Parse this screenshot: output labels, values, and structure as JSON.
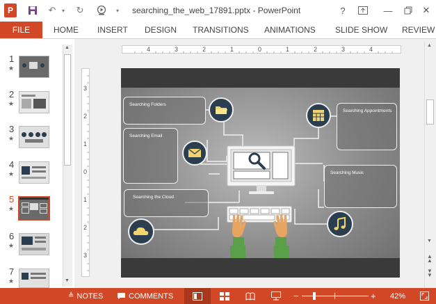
{
  "window": {
    "title": "searching_the_web_17891.pptx - PowerPoint",
    "help": "?",
    "minimize": "—",
    "close": "✕"
  },
  "ribbon": {
    "file": "FILE",
    "tabs": [
      "HOME",
      "INSERT",
      "DESIGN",
      "TRANSITIONS",
      "ANIMATIONS",
      "SLIDE SHOW",
      "REVIEW"
    ]
  },
  "thumbnails": [
    {
      "num": "1",
      "star": "★"
    },
    {
      "num": "2",
      "star": "★"
    },
    {
      "num": "3",
      "star": "★"
    },
    {
      "num": "4",
      "star": "★"
    },
    {
      "num": "5",
      "star": "★",
      "selected": true
    },
    {
      "num": "6",
      "star": "★"
    },
    {
      "num": "7",
      "star": "★"
    }
  ],
  "ruler": {
    "top": [
      "4",
      "3",
      "2",
      "1",
      "0",
      "1",
      "2",
      "3",
      "4"
    ],
    "left": [
      "3",
      "2",
      "1",
      "0",
      "1",
      "2",
      "3"
    ]
  },
  "slide": {
    "boxes": [
      {
        "label": "Searching Folders"
      },
      {
        "label": "Searching Email"
      },
      {
        "label": "Searching the Cloud"
      },
      {
        "label": "Searching Appointments"
      },
      {
        "label": "Searching Music"
      }
    ],
    "icons": [
      "folder-icon",
      "mail-icon",
      "cloud-icon",
      "calendar-icon",
      "music-icon",
      "magnifier-icon"
    ]
  },
  "status": {
    "notes": "NOTES",
    "comments": "COMMENTS",
    "zoom": "42%",
    "zoom_minus": "−",
    "zoom_plus": "+"
  },
  "colors": {
    "accent": "#d24726",
    "slide_band": "#3a3a3a",
    "icon_circle": "#2b3e50",
    "icon_yellow": "#f2d46e"
  }
}
